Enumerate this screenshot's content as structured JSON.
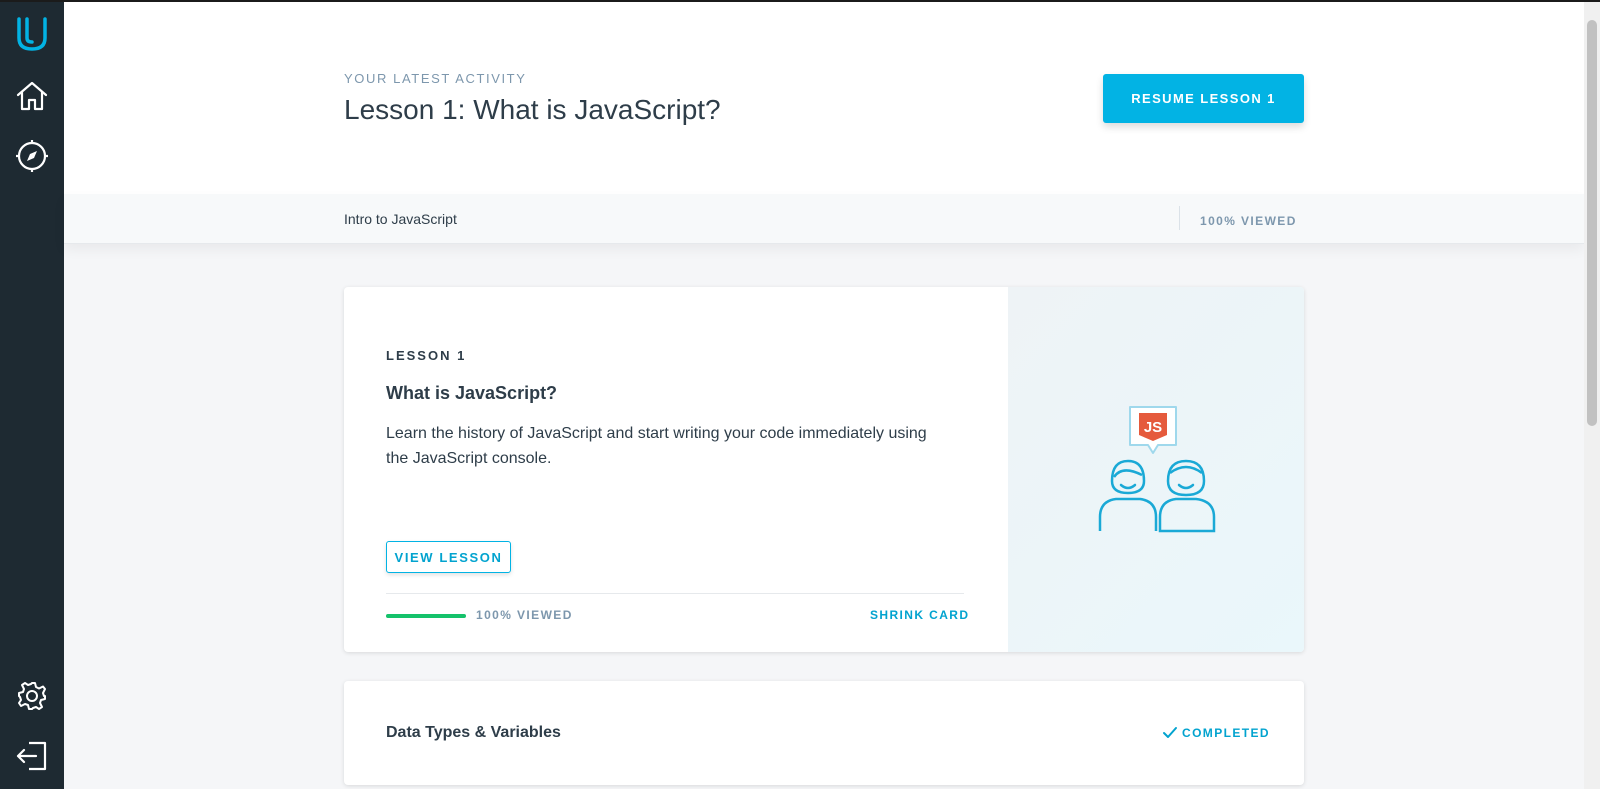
{
  "sidebar": {
    "logo": "udacity-logo-icon",
    "items": [
      {
        "name": "home",
        "icon": "home-icon"
      },
      {
        "name": "explore",
        "icon": "compass-icon"
      }
    ],
    "bottom_items": [
      {
        "name": "settings",
        "icon": "gear-icon"
      },
      {
        "name": "logout",
        "icon": "logout-icon"
      }
    ]
  },
  "header": {
    "eyebrow": "YOUR LATEST ACTIVITY",
    "title": "Lesson 1: What is JavaScript?",
    "resume_label": "RESUME LESSON 1"
  },
  "subbar": {
    "course": "Intro to JavaScript",
    "progress": "100% VIEWED"
  },
  "lesson_card": {
    "number": "LESSON 1",
    "title": "What is JavaScript?",
    "description": "Learn the history of JavaScript and start writing your code immediately using the JavaScript console.",
    "view_label": "VIEW LESSON",
    "progress_fraction": 1.0,
    "progress_label": "100% VIEWED",
    "shrink_label": "SHRINK CARD",
    "illustration": "js-students-illustration",
    "illustration_text": "JS"
  },
  "next_card": {
    "title": "Data Types & Variables",
    "status": "COMPLETED",
    "status_icon": "checkmark-icon"
  },
  "colors": {
    "accent": "#02b3e4",
    "sidebar": "#1e2a32",
    "progress": "#15c26b",
    "js_badge": "#e55a3c"
  }
}
